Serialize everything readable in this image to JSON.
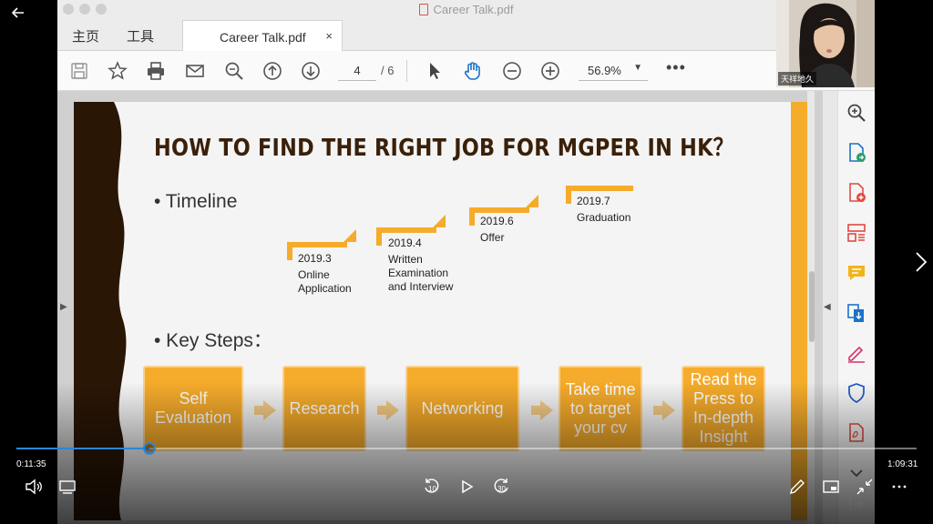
{
  "window": {
    "title": "Career Talk.pdf"
  },
  "menu": {
    "home_label": "主页",
    "tools_label": "工具"
  },
  "tab": {
    "label": "Career Talk.pdf",
    "close_glyph": "×"
  },
  "toolbar": {
    "page_current": "4",
    "page_total": "/ 6",
    "zoom": "56.9%",
    "zoom_caret": "▼",
    "more": "•••"
  },
  "slide": {
    "title": "HOW TO FIND THE RIGHT JOB FOR MGPER IN HK？",
    "timeline_label": "• Timeline",
    "key_steps_label": "• Key Steps：",
    "timeline": [
      {
        "date": "2019.3",
        "desc": "Online\nApplication"
      },
      {
        "date": "2019.4",
        "desc": "Written\nExamination\nand Interview"
      },
      {
        "date": "2019.6",
        "desc": "Offer"
      },
      {
        "date": "2019.7",
        "desc": "Graduation"
      }
    ],
    "steps": [
      {
        "label": "Self\nEvaluation"
      },
      {
        "label": "Research"
      },
      {
        "label": "Networking"
      },
      {
        "label": "Take time\nto target\nyour cv"
      },
      {
        "label": "Read the\nPress to\nIn-depth\nInsight"
      }
    ],
    "accent_color": "#f5ac2a",
    "title_color": "#3a2009"
  },
  "webcam": {
    "name_label": "天祥地久"
  },
  "player": {
    "time_current": "0:11:35",
    "time_total": "1:09:31",
    "progress": 0.148,
    "skip_back_label": "10",
    "skip_forward_label": "30",
    "accent_color": "#2c86d6"
  }
}
